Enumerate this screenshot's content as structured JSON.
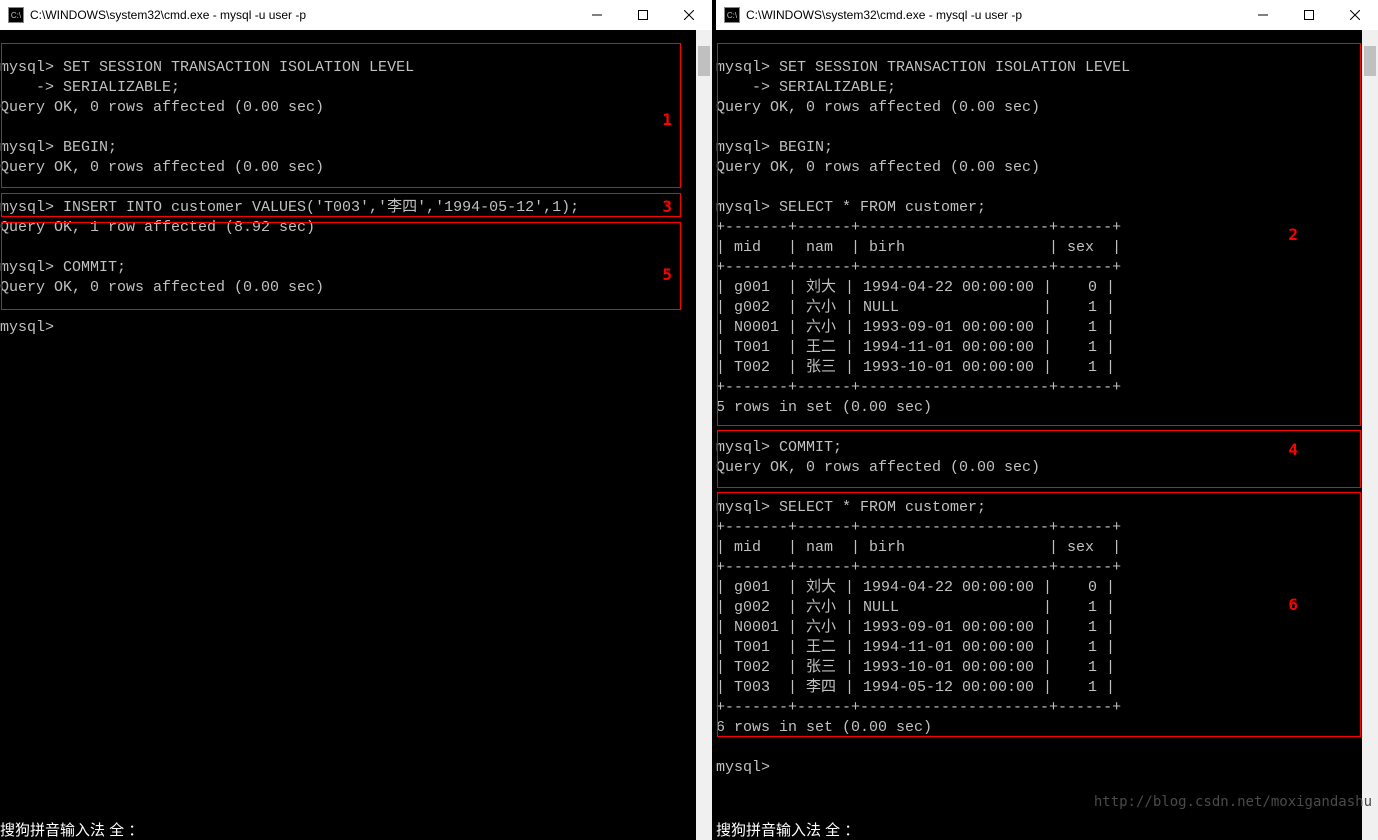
{
  "title": "C:\\WINDOWS\\system32\\cmd.exe - mysql  -u user -p",
  "left": {
    "lines": [
      "mysql> SET SESSION TRANSACTION ISOLATION LEVEL",
      "    -> SERIALIZABLE;",
      "Query OK, 0 rows affected (0.00 sec)",
      "",
      "mysql> BEGIN;",
      "Query OK, 0 rows affected (0.00 sec)",
      "",
      "mysql> INSERT INTO customer VALUES('T003','李四','1994-05-12',1);",
      "Query OK, 1 row affected (8.92 sec)",
      "",
      "mysql> COMMIT;",
      "Query OK, 0 rows affected (0.00 sec)",
      "",
      "mysql>"
    ],
    "annotations": {
      "1": "1",
      "3": "3",
      "5": "5"
    }
  },
  "right": {
    "lines": [
      "mysql> SET SESSION TRANSACTION ISOLATION LEVEL",
      "    -> SERIALIZABLE;",
      "Query OK, 0 rows affected (0.00 sec)",
      "",
      "mysql> BEGIN;",
      "Query OK, 0 rows affected (0.00 sec)",
      "",
      "mysql> SELECT * FROM customer;",
      "+-------+------+---------------------+------+",
      "| mid   | nam  | birh                | sex  |",
      "+-------+------+---------------------+------+",
      "| g001  | 刘大 | 1994-04-22 00:00:00 |    0 |",
      "| g002  | 六小 | NULL                |    1 |",
      "| N0001 | 六小 | 1993-09-01 00:00:00 |    1 |",
      "| T001  | 王二 | 1994-11-01 00:00:00 |    1 |",
      "| T002  | 张三 | 1993-10-01 00:00:00 |    1 |",
      "+-------+------+---------------------+------+",
      "5 rows in set (0.00 sec)",
      "",
      "mysql> COMMIT;",
      "Query OK, 0 rows affected (0.00 sec)",
      "",
      "mysql> SELECT * FROM customer;",
      "+-------+------+---------------------+------+",
      "| mid   | nam  | birh                | sex  |",
      "+-------+------+---------------------+------+",
      "| g001  | 刘大 | 1994-04-22 00:00:00 |    0 |",
      "| g002  | 六小 | NULL                |    1 |",
      "| N0001 | 六小 | 1993-09-01 00:00:00 |    1 |",
      "| T001  | 王二 | 1994-11-01 00:00:00 |    1 |",
      "| T002  | 张三 | 1993-10-01 00:00:00 |    1 |",
      "| T003  | 李四 | 1994-05-12 00:00:00 |    1 |",
      "+-------+------+---------------------+------+",
      "6 rows in set (0.00 sec)",
      "",
      "mysql>"
    ],
    "annotations": {
      "2": "2",
      "4": "4",
      "6": "6"
    }
  },
  "ime": "搜狗拼音输入法 全 ：",
  "watermark": "http://blog.csdn.net/moxigandashu"
}
